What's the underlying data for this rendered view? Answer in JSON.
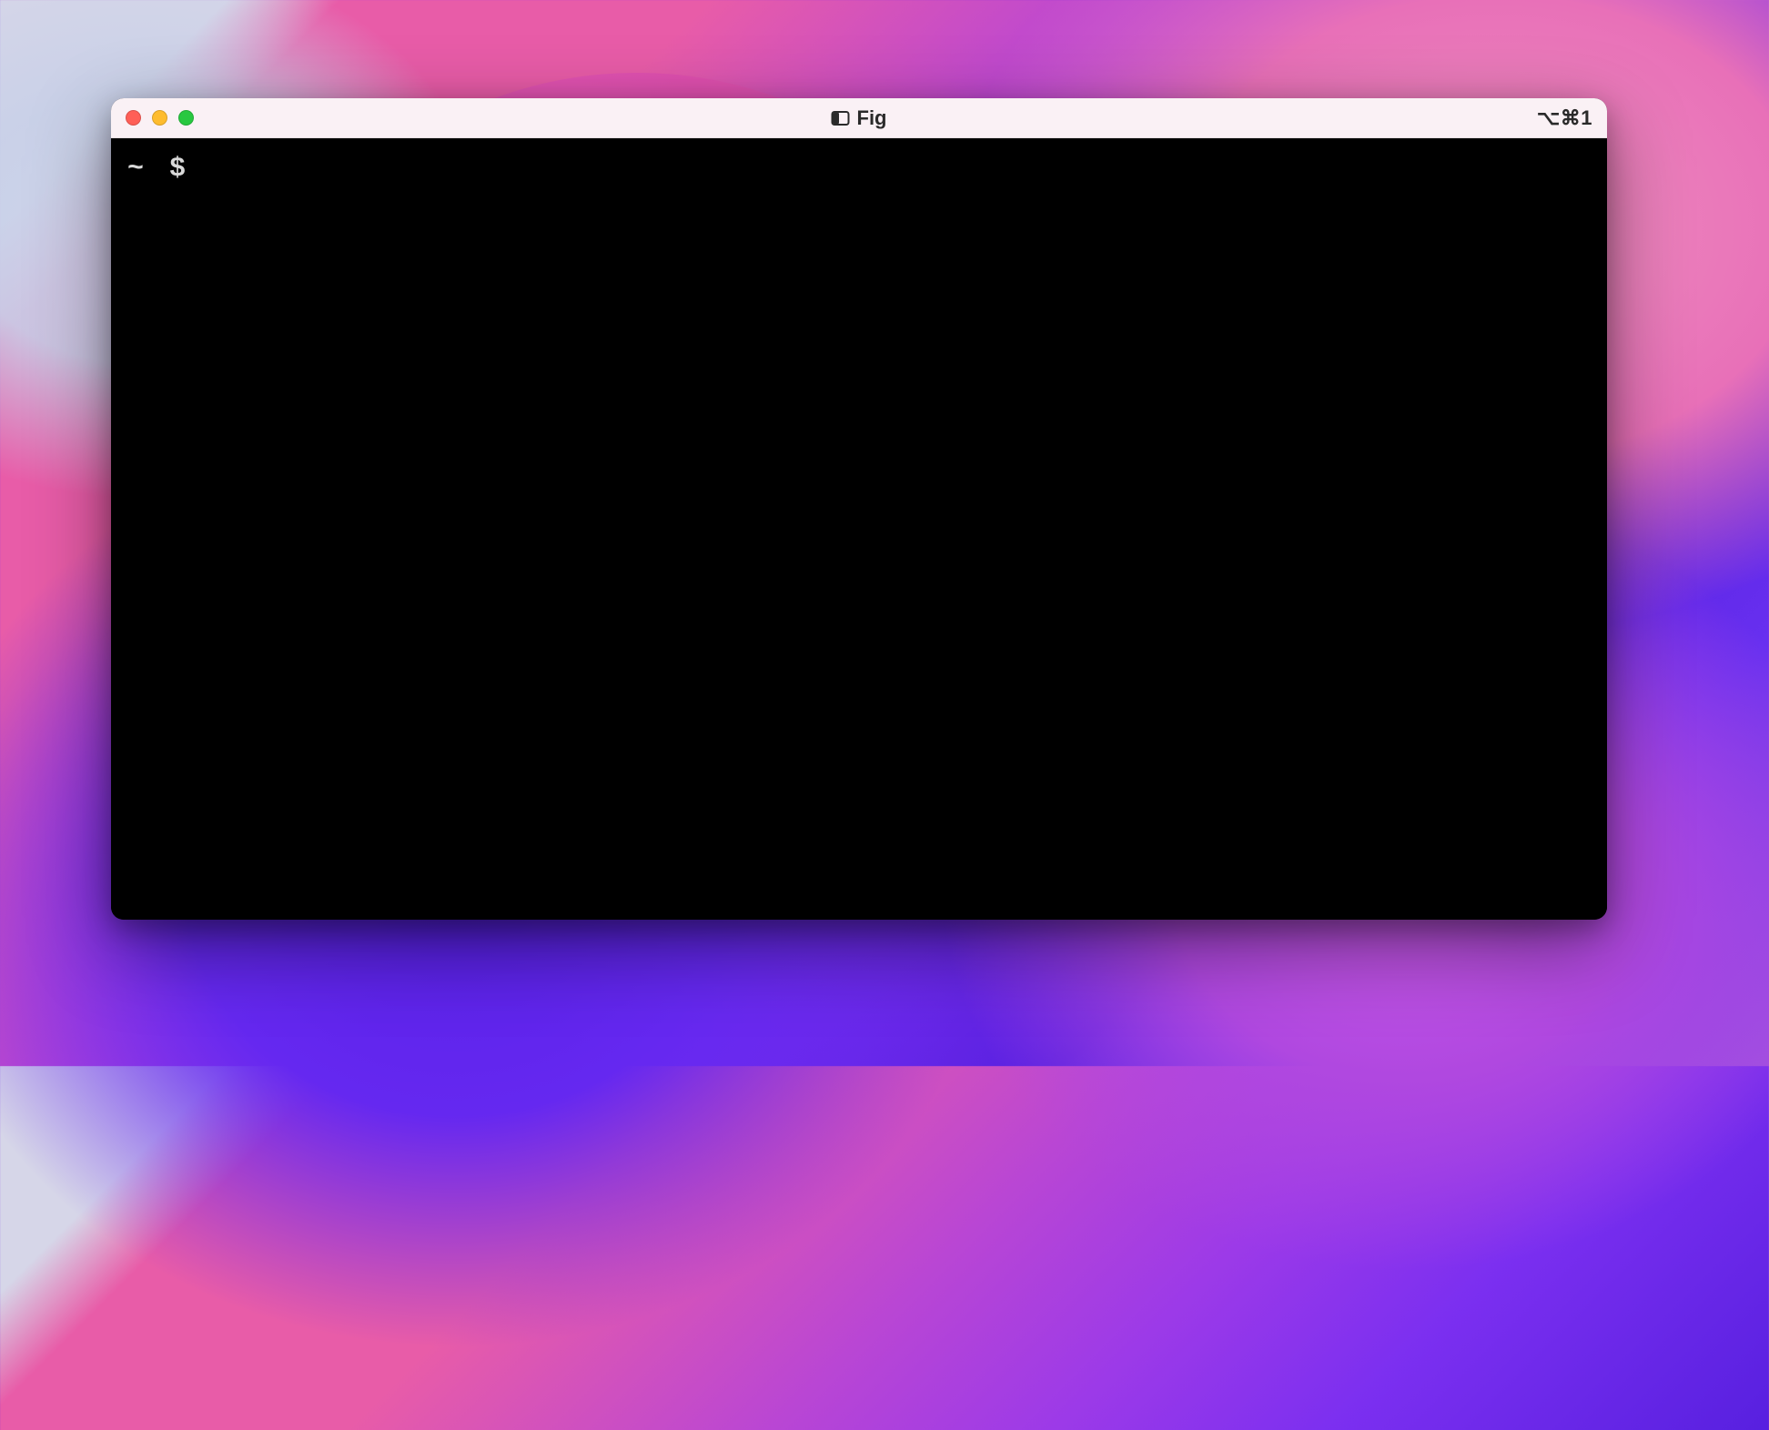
{
  "window": {
    "title": "Fig",
    "shortcut_hint": "⌥⌘1"
  },
  "traffic_lights": {
    "close_color": "#ff5f57",
    "minimize_color": "#febc2e",
    "maximize_color": "#28c840"
  },
  "terminal": {
    "prompt_path": "~",
    "prompt_symbol": "$",
    "input_value": ""
  }
}
